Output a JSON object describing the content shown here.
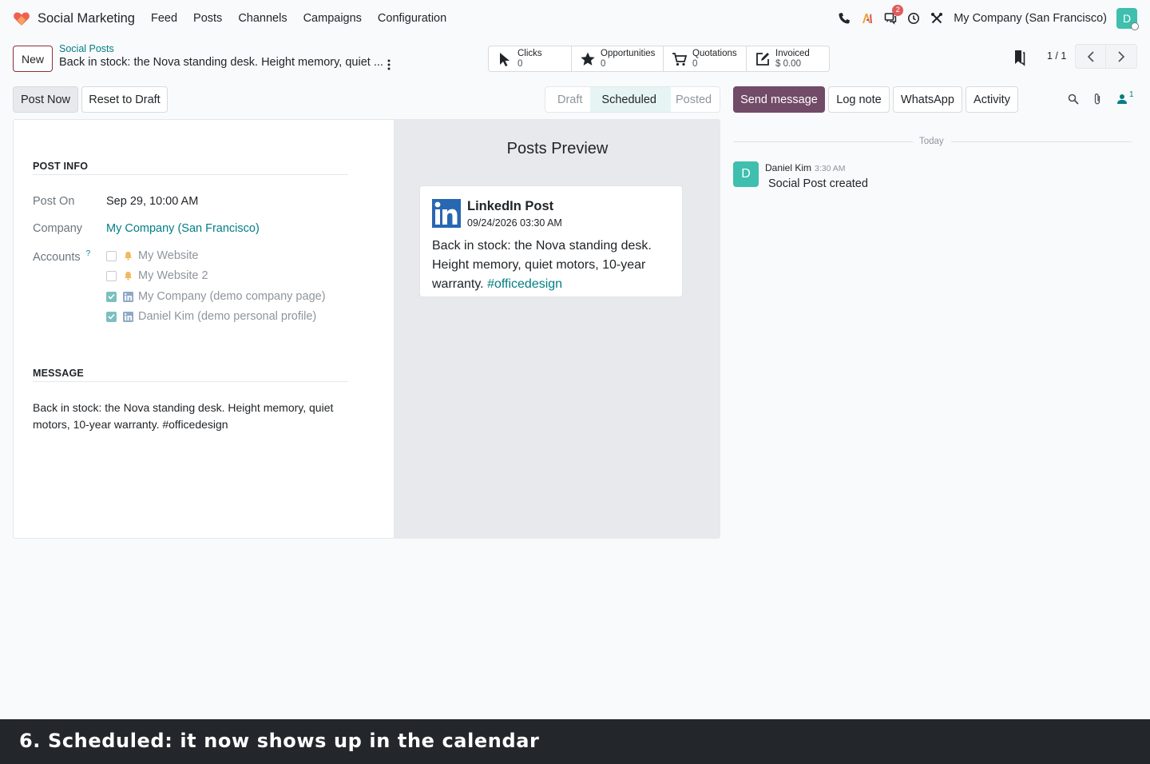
{
  "navbar": {
    "app_name": "Social Marketing",
    "menu": [
      "Feed",
      "Posts",
      "Channels",
      "Campaigns",
      "Configuration"
    ],
    "chat_badge": "2",
    "company": "My Company (San Francisco)",
    "user_initial": "D"
  },
  "control_panel": {
    "new_label": "New",
    "breadcrumb_parent": "Social Posts",
    "breadcrumb_current": "Back in stock: the Nova standing desk. Height memory, quiet ...",
    "stats": [
      {
        "label": "Clicks",
        "value": "0",
        "icon": "cursor-icon"
      },
      {
        "label": "Opportunities",
        "value": "0",
        "icon": "star-icon"
      },
      {
        "label": "Quotations",
        "value": "0",
        "icon": "cart-icon"
      },
      {
        "label": "Invoiced",
        "value": "$ 0.00",
        "icon": "edit-icon"
      }
    ],
    "pager": "1 / 1"
  },
  "form_actions": {
    "post_now": "Post Now",
    "reset_draft": "Reset to Draft"
  },
  "statusbar": {
    "stages": [
      "Draft",
      "Scheduled",
      "Posted"
    ],
    "active": "Scheduled"
  },
  "chatter": {
    "send_message": "Send message",
    "log_note": "Log note",
    "whatsapp": "WhatsApp",
    "activity": "Activity",
    "followers": "1",
    "date_separator": "Today",
    "message": {
      "author": "Daniel Kim",
      "time": "3:30 AM",
      "body": "Social Post created",
      "initial": "D"
    }
  },
  "post_info": {
    "section_title": "POST INFO",
    "post_on_label": "Post On",
    "post_on_value": "Sep 29, 10:00 AM",
    "company_label": "Company",
    "company_value": "My Company (San Francisco)",
    "accounts_label": "Accounts",
    "help": "?",
    "accounts": [
      {
        "name": "My Website",
        "checked": false,
        "icon": "bell-icon"
      },
      {
        "name": "My Website 2",
        "checked": false,
        "icon": "bell-icon"
      },
      {
        "name": "My Company (demo company page)",
        "checked": true,
        "icon": "linkedin-icon"
      },
      {
        "name": "Daniel Kim (demo personal profile)",
        "checked": true,
        "icon": "linkedin-icon"
      }
    ]
  },
  "message_section": {
    "title": "MESSAGE",
    "text": "Back in stock: the Nova standing desk. Height memory, quiet motors, 10-year warranty. #officedesign"
  },
  "preview": {
    "title": "Posts Preview",
    "card_title": "LinkedIn Post",
    "card_date": "09/24/2026 03:30 AM",
    "card_text": "Back in stock: the Nova standing desk. Height memory, quiet motors, 10-year warranty.",
    "card_hashtag": "#officedesign"
  },
  "caption": "6. Scheduled: it now shows up in the calendar",
  "colors": {
    "primary": "#714b67",
    "link": "#017e84",
    "linkedin": "#2867b2",
    "caption_bg": "#23272b"
  }
}
